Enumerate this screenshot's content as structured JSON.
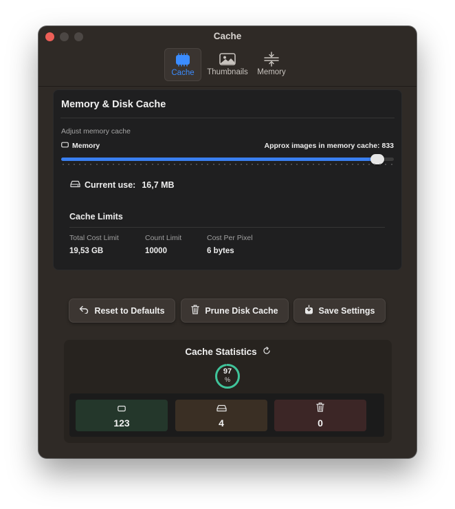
{
  "window": {
    "title": "Cache"
  },
  "toolbar": {
    "tabs": [
      {
        "label": "Cache",
        "icon": "chip-icon",
        "active": true
      },
      {
        "label": "Thumbnails",
        "icon": "photo-icon",
        "active": false
      },
      {
        "label": "Memory",
        "icon": "memory-compress-icon",
        "active": false
      }
    ]
  },
  "memory_card": {
    "title": "Memory & Disk Cache",
    "adjust_label": "Adjust memory cache",
    "slider_label": "Memory",
    "approx_images": "Approx images in memory cache: 833",
    "slider_value_fraction": 0.95,
    "current_use_label": "Current use:",
    "current_use_value": "16,7 MB",
    "limits_title": "Cache Limits",
    "limits": [
      {
        "label": "Total Cost Limit",
        "value": "19,53 GB"
      },
      {
        "label": "Count Limit",
        "value": "10000"
      },
      {
        "label": "Cost Per Pixel",
        "value": "6 bytes"
      }
    ]
  },
  "actions": {
    "reset_label": "Reset to Defaults",
    "prune_label": "Prune Disk Cache",
    "save_label": "Save Settings"
  },
  "statistics": {
    "title": "Cache Statistics",
    "hit_rate": "97",
    "hit_rate_unit": "%",
    "hit_rate_fraction": 0.97,
    "memory_count": "123",
    "disk_count": "4",
    "evicted_count": "0"
  },
  "colors": {
    "accent": "#3a7ff0",
    "close": "#ed5f57",
    "ring": "#3fc49a",
    "memory_stat_bg": "#24372b",
    "disk_stat_bg": "#3a2f24",
    "evicted_stat_bg": "#3c2626"
  }
}
